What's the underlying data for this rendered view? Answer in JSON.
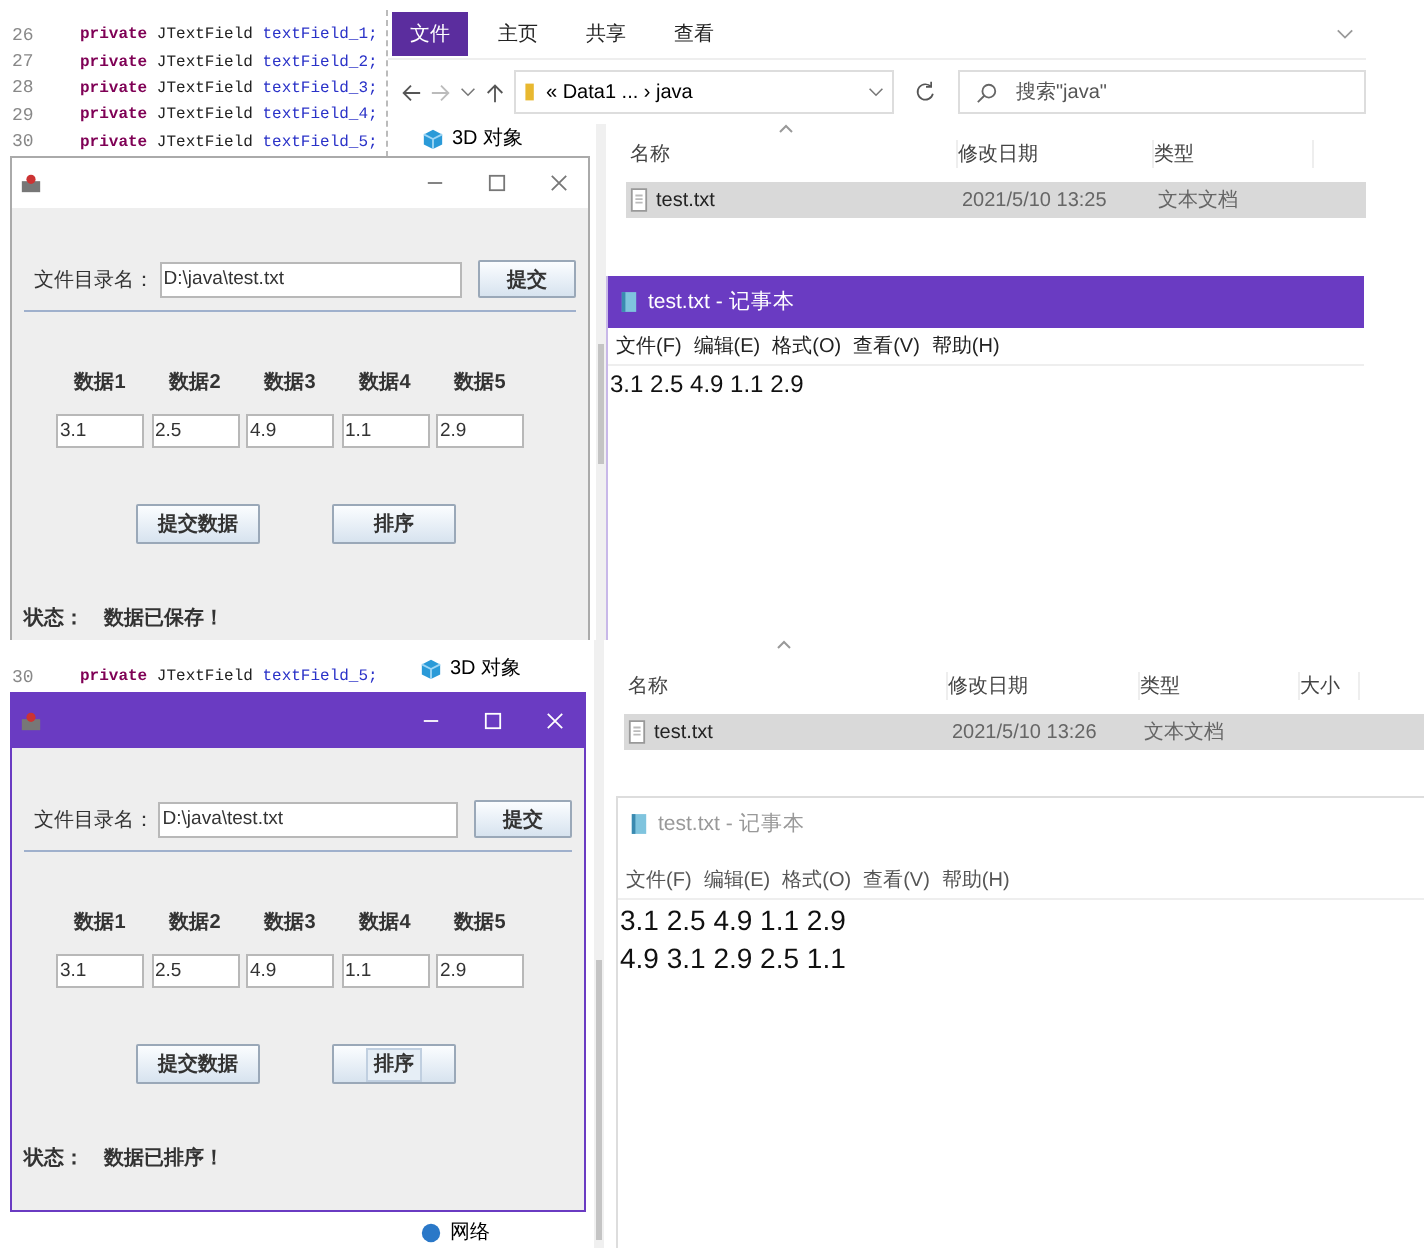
{
  "screens": [
    {
      "code_lines": [
        {
          "number": "26",
          "keyword": "private",
          "type": "JTextField",
          "name": "textField_1;"
        },
        {
          "number": "27",
          "keyword": "private",
          "type": "JTextField",
          "name": "textField_2;"
        },
        {
          "number": "28",
          "keyword": "private",
          "type": "JTextField",
          "name": "textField_3;"
        },
        {
          "number": "29",
          "keyword": "private",
          "type": "JTextField",
          "name": "textField_4;"
        },
        {
          "number": "30",
          "keyword": "private",
          "type": "JTextField",
          "name": "textField_5;"
        }
      ],
      "explorer": {
        "ribbon_tabs": [
          {
            "label": "文件",
            "selected": true
          },
          {
            "label": "主页",
            "selected": false
          },
          {
            "label": "共享",
            "selected": false
          },
          {
            "label": "查看",
            "selected": false
          }
        ],
        "path": "« Data1 ... › java",
        "search": {
          "placeholder": "搜索\"java\""
        },
        "nav_items": [
          {
            "label": "3D 对象",
            "kind": "object"
          }
        ],
        "columns": [
          "名称",
          "修改日期",
          "类型"
        ],
        "files": [
          {
            "name": "test.txt",
            "modified": "2021/5/10 13:25",
            "type": "文本文档",
            "selected": true
          }
        ]
      },
      "app_window": {
        "active": false,
        "path_label": "文件目录名：",
        "path_value": "D:\\java\\test.txt",
        "submit_button": "提交",
        "data_labels": [
          "数据1",
          "数据2",
          "数据3",
          "数据4",
          "数据5"
        ],
        "data_values": [
          "3.1",
          "2.5",
          "4.9",
          "1.1",
          "2.9"
        ],
        "buttons": [
          {
            "label": "提交数据",
            "focused": false
          },
          {
            "label": "排序",
            "focused": false
          }
        ],
        "status_label": "状态：",
        "status_text": "数据已保存！"
      },
      "notepad": {
        "active": true,
        "title": "test.txt - 记事本",
        "menu": [
          "文件(F)",
          "编辑(E)",
          "格式(O)",
          "查看(V)",
          "帮助(H)"
        ],
        "lines": [
          "3.1 2.5 4.9 1.1 2.9"
        ]
      }
    },
    {
      "code_lines": [
        {
          "number": "30",
          "keyword": "private",
          "type": "JTextField",
          "name": "textField_5;"
        }
      ],
      "explorer": {
        "nav_items": [
          {
            "label": "3D 对象",
            "kind": "object"
          },
          {
            "label": "网络",
            "kind": "network"
          }
        ],
        "columns": [
          "名称",
          "修改日期",
          "类型",
          "大小"
        ],
        "files": [
          {
            "name": "test.txt",
            "modified": "2021/5/10 13:26",
            "type": "文本文档",
            "selected": true
          }
        ]
      },
      "app_window": {
        "active": true,
        "path_label": "文件目录名：",
        "path_value": "D:\\java\\test.txt",
        "submit_button": "提交",
        "data_labels": [
          "数据1",
          "数据2",
          "数据3",
          "数据4",
          "数据5"
        ],
        "data_values": [
          "3.1",
          "2.5",
          "4.9",
          "1.1",
          "2.9"
        ],
        "buttons": [
          {
            "label": "提交数据",
            "focused": false
          },
          {
            "label": "排序",
            "focused": true
          }
        ],
        "status_label": "状态：",
        "status_text": "数据已排序！"
      },
      "notepad": {
        "active": false,
        "title": "test.txt - 记事本",
        "menu": [
          "文件(F)",
          "编辑(E)",
          "格式(O)",
          "查看(V)",
          "帮助(H)"
        ],
        "lines": [
          "3.1 2.5 4.9 1.1 2.9",
          "4.9 3.1 2.9 2.5 1.1"
        ]
      }
    }
  ]
}
